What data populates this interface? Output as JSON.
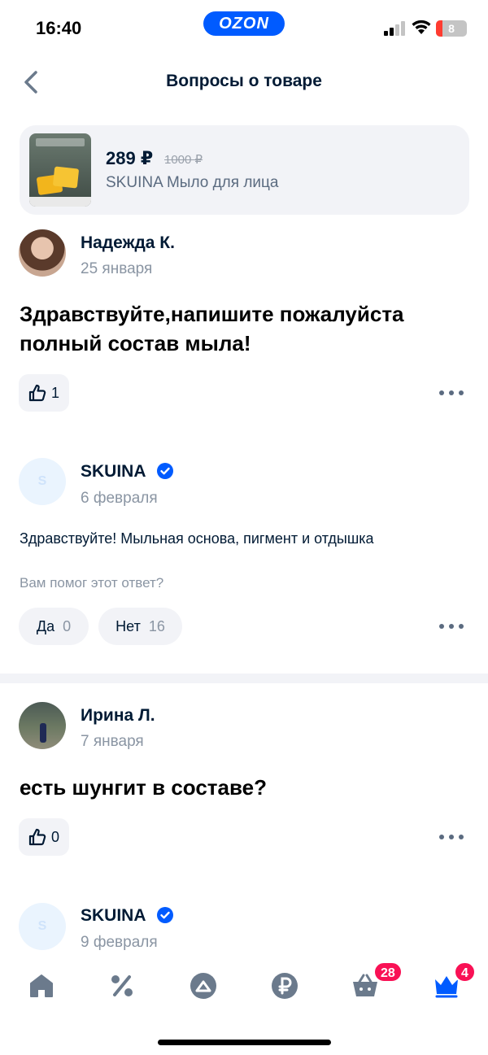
{
  "status_bar": {
    "time": "16:40",
    "app_badge": "OZON",
    "battery": "8",
    "battery_color": "#ff3b30"
  },
  "header": {
    "title": "Вопросы о товаре"
  },
  "product": {
    "price": "289 ₽",
    "old_price": "1000 ₽",
    "name": "SKUINA Мыло для лица"
  },
  "questions": [
    {
      "author": "Надежда К.",
      "date": "25 января",
      "text_line1": "Здравствуйте,напишите пожалуйста",
      "text_line2": "полный состав мыла!",
      "likes": "1",
      "answer": {
        "author": "SKUINA",
        "avatar_letter": "S",
        "date": "6 февраля",
        "text": "Здравствуйте! Мыльная основа, пигмент и отдышка",
        "helpful_prompt": "Вам помог этот ответ?",
        "yes_label": "Да",
        "yes_count": "0",
        "no_label": "Нет",
        "no_count": "16"
      }
    },
    {
      "author": "Ирина Л.",
      "date": "7 января",
      "text_line1": "есть шунгит в составе?",
      "likes": "0",
      "answer": {
        "author": "SKUINA",
        "avatar_letter": "S",
        "date": "9 февраля"
      }
    }
  ],
  "bottom_nav": {
    "items": [
      "home-icon",
      "percent-icon",
      "fresh-icon",
      "ruble-icon",
      "cart-icon",
      "crown-icon"
    ],
    "cart_badge": "28",
    "profile_badge": "4",
    "accent": "#005bff",
    "badge_color": "#f91155"
  }
}
